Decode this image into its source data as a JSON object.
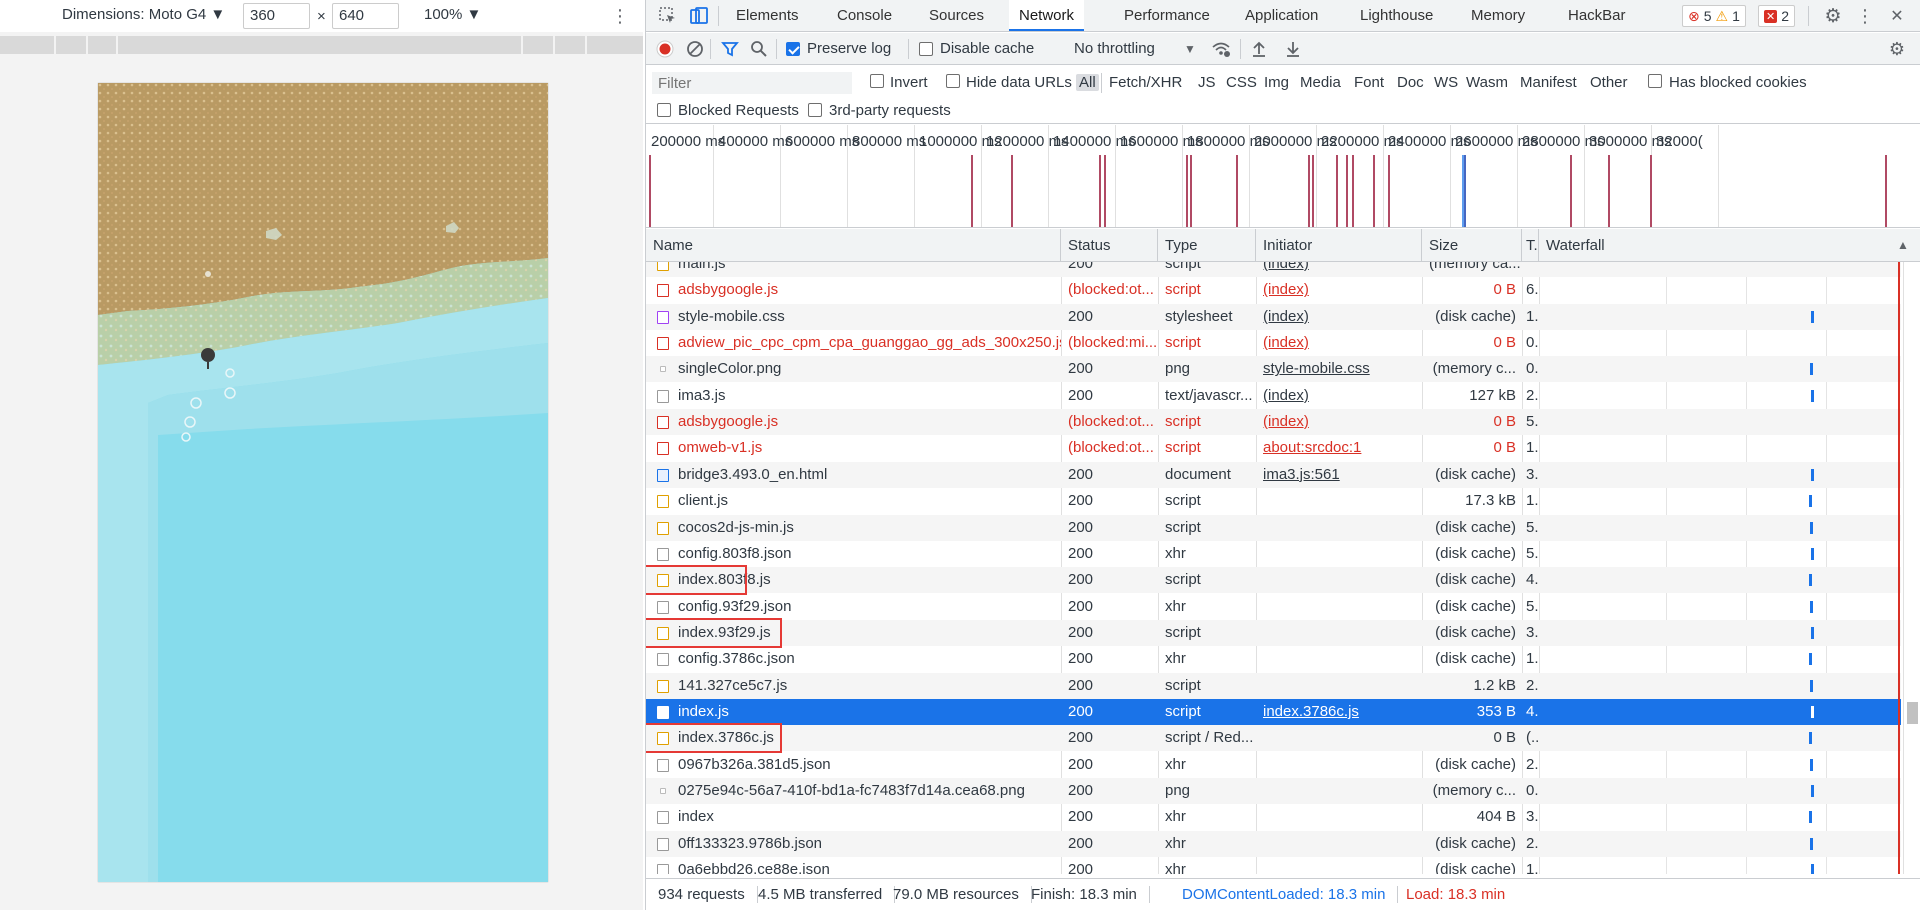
{
  "device_toolbar": {
    "dimensions_label": "Dimensions: Moto G4 ▼",
    "width": "360",
    "times": "×",
    "height": "640",
    "zoom": "100% ▼"
  },
  "tabs": {
    "elements": "Elements",
    "console": "Console",
    "sources": "Sources",
    "network": "Network",
    "performance": "Performance",
    "application": "Application",
    "lighthouse": "Lighthouse",
    "memory": "Memory",
    "hackbar": "HackBar"
  },
  "badges": {
    "errors": "5",
    "warnings": "1",
    "issues": "2"
  },
  "net_toolbar": {
    "preserve_log": "Preserve log",
    "disable_cache": "Disable cache",
    "throttling": "No throttling"
  },
  "filter_bar": {
    "placeholder": "Filter",
    "invert": "Invert",
    "hide_data_urls": "Hide data URLs",
    "types": [
      "All",
      "Fetch/XHR",
      "JS",
      "CSS",
      "Img",
      "Media",
      "Font",
      "Doc",
      "WS",
      "Wasm",
      "Manifest",
      "Other"
    ],
    "has_blocked_cookies": "Has blocked cookies",
    "blocked_requests": "Blocked Requests",
    "third_party": "3rd-party requests"
  },
  "overview_ticks": [
    "200000 ms",
    "400000 ms",
    "600000 ms",
    "800000 ms",
    "1000000 ms",
    "1200000 ms",
    "1400000 ms",
    "1600000 ms",
    "1800000 ms",
    "2000000 ms",
    "2200000 ms",
    "2400000 ms",
    "2600000 ms",
    "2800000 ms",
    "3000000 ms",
    "32000("
  ],
  "columns": {
    "name": "Name",
    "status": "Status",
    "type": "Type",
    "initiator": "Initiator",
    "size": "Size",
    "time": "T.",
    "waterfall": "Waterfall"
  },
  "rows": [
    {
      "name": "main.js",
      "status": "200",
      "type": "script",
      "initiator": "(index)",
      "size": "(memory ca...",
      "time": "",
      "icon": "script"
    },
    {
      "name": "adsbygoogle.js",
      "status": "(blocked:ot...",
      "type": "script",
      "initiator": "(index)",
      "size": "0 B",
      "time": "6.",
      "icon": "script",
      "err": true
    },
    {
      "name": "style-mobile.css",
      "status": "200",
      "type": "stylesheet",
      "initiator": "(index)",
      "size": "(disk cache)",
      "time": "1.",
      "icon": "css"
    },
    {
      "name": "adview_pic_cpc_cpm_cpa_guanggao_gg_ads_300x250.js",
      "status": "(blocked:mi...",
      "type": "script",
      "initiator": "(index)",
      "size": "0 B",
      "time": "0.",
      "icon": "script",
      "err": true
    },
    {
      "name": "singleColor.png",
      "status": "200",
      "type": "png",
      "initiator": "style-mobile.css",
      "size": "(memory c...",
      "time": "0.",
      "icon": "img"
    },
    {
      "name": "ima3.js",
      "status": "200",
      "type": "text/javascr...",
      "initiator": "(index)",
      "size": "127 kB",
      "time": "2.",
      "icon": "plain"
    },
    {
      "name": "adsbygoogle.js",
      "status": "(blocked:ot...",
      "type": "script",
      "initiator": "(index)",
      "size": "0 B",
      "time": "5.",
      "icon": "script",
      "err": true
    },
    {
      "name": "omweb-v1.js",
      "status": "(blocked:ot...",
      "type": "script",
      "initiator": "about:srcdoc:1",
      "size": "0 B",
      "time": "1.",
      "icon": "script",
      "err": true
    },
    {
      "name": "bridge3.493.0_en.html",
      "status": "200",
      "type": "document",
      "initiator": "ima3.js:561",
      "size": "(disk cache)",
      "time": "3.",
      "icon": "doc"
    },
    {
      "name": "client.js",
      "status": "200",
      "type": "script",
      "initiator": "",
      "size": "17.3 kB",
      "time": "1.",
      "icon": "script"
    },
    {
      "name": "cocos2d-js-min.js",
      "status": "200",
      "type": "script",
      "initiator": "",
      "size": "(disk cache)",
      "time": "5.",
      "icon": "script"
    },
    {
      "name": "config.803f8.json",
      "status": "200",
      "type": "xhr",
      "initiator": "",
      "size": "(disk cache)",
      "time": "5.",
      "icon": "plain"
    },
    {
      "name": "index.803f8.js",
      "status": "200",
      "type": "script",
      "initiator": "",
      "size": "(disk cache)",
      "time": "4.",
      "icon": "script"
    },
    {
      "name": "config.93f29.json",
      "status": "200",
      "type": "xhr",
      "initiator": "",
      "size": "(disk cache)",
      "time": "5.",
      "icon": "plain"
    },
    {
      "name": "index.93f29.js",
      "status": "200",
      "type": "script",
      "initiator": "",
      "size": "(disk cache)",
      "time": "3.",
      "icon": "script"
    },
    {
      "name": "config.3786c.json",
      "status": "200",
      "type": "xhr",
      "initiator": "",
      "size": "(disk cache)",
      "time": "1.",
      "icon": "plain"
    },
    {
      "name": "141.327ce5c7.js",
      "status": "200",
      "type": "script",
      "initiator": "",
      "size": "1.2 kB",
      "time": "2.",
      "icon": "script"
    },
    {
      "name": "index.js",
      "status": "200",
      "type": "script",
      "initiator": "index.3786c.js",
      "size": "353 B",
      "time": "4.",
      "icon": "script",
      "selected": true
    },
    {
      "name": "index.3786c.js",
      "status": "200",
      "type": "script / Red...",
      "initiator": "",
      "size": "0 B",
      "time": "(..",
      "icon": "script"
    },
    {
      "name": "0967b326a.381d5.json",
      "status": "200",
      "type": "xhr",
      "initiator": "",
      "size": "(disk cache)",
      "time": "2.",
      "icon": "plain"
    },
    {
      "name": "0275e94c-56a7-410f-bd1a-fc7483f7d14a.cea68.png",
      "status": "200",
      "type": "png",
      "initiator": "",
      "size": "(memory c...",
      "time": "0.",
      "icon": "img"
    },
    {
      "name": "index",
      "status": "200",
      "type": "xhr",
      "initiator": "",
      "size": "404 B",
      "time": "3.",
      "icon": "plain"
    },
    {
      "name": "0ff133323.9786b.json",
      "status": "200",
      "type": "xhr",
      "initiator": "",
      "size": "(disk cache)",
      "time": "2.",
      "icon": "plain"
    },
    {
      "name": "0a6ebbd26.ce88e.json",
      "status": "200",
      "type": "xhr",
      "initiator": "",
      "size": "(disk cache)",
      "time": "1.",
      "icon": "plain"
    }
  ],
  "status_bar": {
    "requests": "934 requests",
    "transferred": "4.5 MB transferred",
    "resources": "79.0 MB resources",
    "finish": "Finish: 18.3 min",
    "dcl": "DOMContentLoaded: 18.3 min",
    "load": "Load: 18.3 min"
  },
  "colors": {
    "accent": "#1a73e8",
    "error": "#d93025",
    "highlight_box": "#e53935"
  }
}
